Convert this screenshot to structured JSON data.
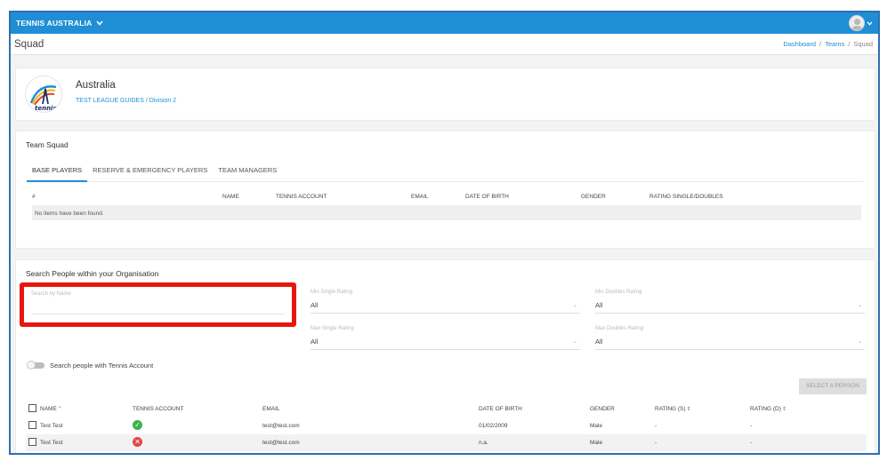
{
  "topbar": {
    "org_name": "TENNIS AUSTRALIA"
  },
  "header": {
    "page_title": "Squad",
    "breadcrumb": [
      "Dashboard",
      "Teams",
      "Squad"
    ]
  },
  "team": {
    "name": "Australia",
    "subtitle": "TEST LEAGUE GUIDES / Division 2",
    "logo_text": "tennis"
  },
  "squad": {
    "title": "Team Squad",
    "tabs": [
      "BASE PLAYERS",
      "RESERVE & EMERGENCY PLAYERS",
      "TEAM MANAGERS"
    ],
    "active_tab": 0,
    "columns": [
      "#",
      "NAME",
      "TENNIS ACCOUNT",
      "EMAIL",
      "DATE OF BIRTH",
      "GENDER",
      "RATING SINGLE/DOUBLES"
    ],
    "empty_text": "No items have been found."
  },
  "search": {
    "title": "Search People within your Organisation",
    "name_label": "Search by Name",
    "name_value": "",
    "filters": {
      "min_single": {
        "label": "Min Single Rating",
        "value": "All"
      },
      "min_doubles": {
        "label": "Min Doubles Rating",
        "value": "All"
      },
      "max_single": {
        "label": "Max Single Rating",
        "value": "All"
      },
      "max_doubles": {
        "label": "Max Doubles Rating",
        "value": "All"
      }
    },
    "toggle_label": "Search people with Tennis Account",
    "toggle_on": false,
    "select_button": "SELECT A PERSON"
  },
  "people": {
    "columns": [
      "NAME",
      "TENNIS ACCOUNT",
      "EMAIL",
      "DATE OF BIRTH",
      "GENDER",
      "RATING (S)",
      "RATING (D)"
    ],
    "rows": [
      {
        "name": "Test Test",
        "account_icon": "check-circle-icon",
        "has_account": true,
        "email": "test@test.com",
        "dob": "01/02/2009",
        "gender": "Male",
        "rating_s": "-",
        "rating_d": "-"
      },
      {
        "name": "Test Test",
        "account_icon": "cross-circle-icon",
        "has_account": false,
        "email": "test@test.com",
        "dob": "n.a.",
        "gender": "Male",
        "rating_s": "-",
        "rating_d": "-"
      }
    ]
  },
  "colors": {
    "topbar": "#1f8ed4",
    "accent_link": "#1f8ed4",
    "highlight_box": "#e8170d",
    "frame_border": "#2d6fb5",
    "check_green": "#3db24b",
    "cross_red": "#e24747"
  }
}
